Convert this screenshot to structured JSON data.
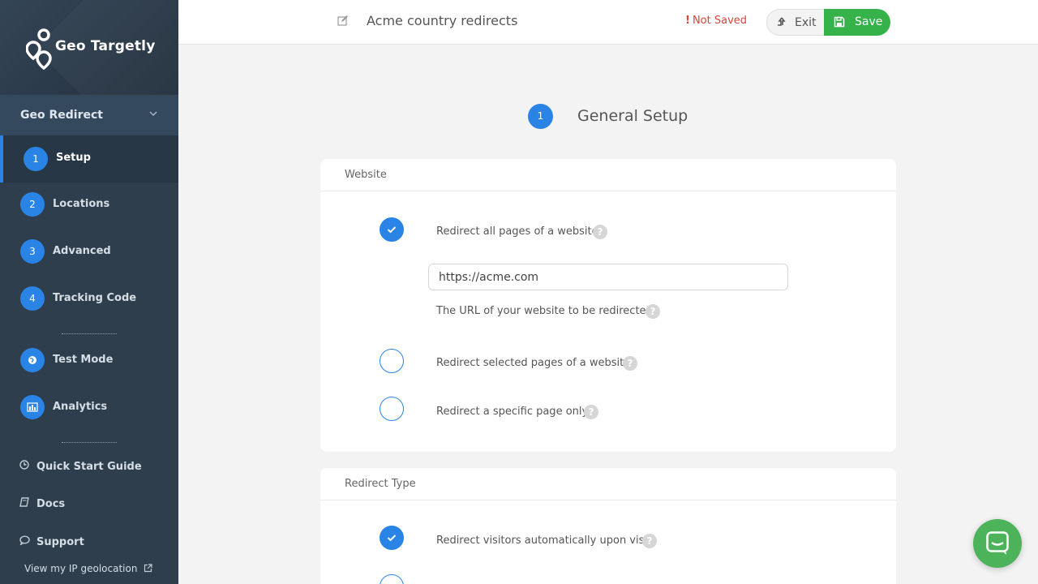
{
  "brand": {
    "name": "Geo Targetly"
  },
  "sidebar": {
    "section": "Geo Redirect",
    "steps": [
      {
        "num": "1",
        "label": "Setup"
      },
      {
        "num": "2",
        "label": "Locations"
      },
      {
        "num": "3",
        "label": "Advanced"
      },
      {
        "num": "4",
        "label": "Tracking Code"
      }
    ],
    "tools": [
      {
        "label": "Test Mode",
        "icon": "globe-icon"
      },
      {
        "label": "Analytics",
        "icon": "bar-chart-icon"
      }
    ],
    "links": [
      {
        "label": "Quick Start Guide",
        "icon": "clock-icon"
      },
      {
        "label": "Docs",
        "icon": "book-icon"
      },
      {
        "label": "Support",
        "icon": "chat-bubble-icon"
      }
    ],
    "ip_link": "View my IP geolocation"
  },
  "topbar": {
    "title": "Acme country redirects",
    "status": "Not Saved",
    "exit_label": "Exit",
    "save_label": "Save"
  },
  "step": {
    "num": "1",
    "title": "General Setup"
  },
  "website_card": {
    "title": "Website",
    "option1": "Redirect all pages of a website",
    "url_value": "https://acme.com",
    "url_hint": "The URL of your website to be redirected",
    "option2": "Redirect selected pages of a website",
    "option3": "Redirect a specific page only"
  },
  "redirect_card": {
    "title": "Redirect Type",
    "option1": "Redirect visitors automatically upon visit"
  },
  "colors": {
    "accent": "#2a84e5",
    "save": "#35b34a",
    "warning": "#d9453d",
    "sidebar": "#2f3e4d"
  }
}
